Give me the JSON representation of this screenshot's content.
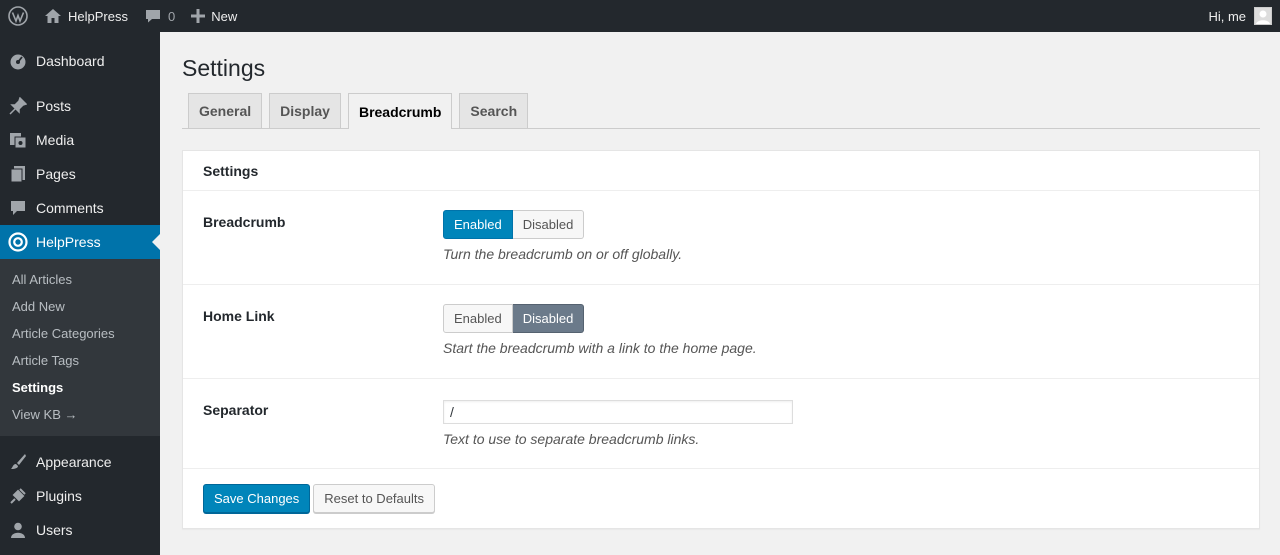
{
  "adminbar": {
    "wp_logo_icon": "wordpress-logo-icon",
    "site_name": "HelpPress",
    "comments_count": "0",
    "new_label": "New",
    "greeting": "Hi, me"
  },
  "sidebar": {
    "top_items": [
      {
        "label": "Dashboard",
        "icon": "dashboard-icon"
      },
      {
        "label": "Posts",
        "icon": "pin-icon"
      },
      {
        "label": "Media",
        "icon": "media-icon"
      },
      {
        "label": "Pages",
        "icon": "pages-icon"
      },
      {
        "label": "Comments",
        "icon": "comment-icon"
      },
      {
        "label": "HelpPress",
        "icon": "lifebuoy-icon"
      }
    ],
    "submenu": [
      {
        "label": "All Articles"
      },
      {
        "label": "Add New"
      },
      {
        "label": "Article Categories"
      },
      {
        "label": "Article Tags"
      },
      {
        "label": "Settings"
      },
      {
        "label": "View KB →"
      }
    ],
    "bottom_items": [
      {
        "label": "Appearance",
        "icon": "brush-icon"
      },
      {
        "label": "Plugins",
        "icon": "plug-icon"
      },
      {
        "label": "Users",
        "icon": "user-icon"
      }
    ]
  },
  "page": {
    "title": "Settings",
    "tabs": [
      {
        "label": "General"
      },
      {
        "label": "Display"
      },
      {
        "label": "Breadcrumb"
      },
      {
        "label": "Search"
      }
    ]
  },
  "settings_box": {
    "heading": "Settings",
    "breadcrumb": {
      "label": "Breadcrumb",
      "enabled_label": "Enabled",
      "disabled_label": "Disabled",
      "description": "Turn the breadcrumb on or off globally."
    },
    "home_link": {
      "label": "Home Link",
      "enabled_label": "Enabled",
      "disabled_label": "Disabled",
      "description": "Start the breadcrumb with a link to the home page."
    },
    "separator": {
      "label": "Separator",
      "value": "/",
      "description": "Text to use to separate breadcrumb links."
    },
    "save_label": "Save Changes",
    "reset_label": "Reset to Defaults"
  },
  "colors": {
    "accent": "#0073aa",
    "primary_button": "#0085ba",
    "sidebar_bg": "#23282d",
    "submenu_bg": "#32373c",
    "disabled_active": "#6b7a8a"
  }
}
